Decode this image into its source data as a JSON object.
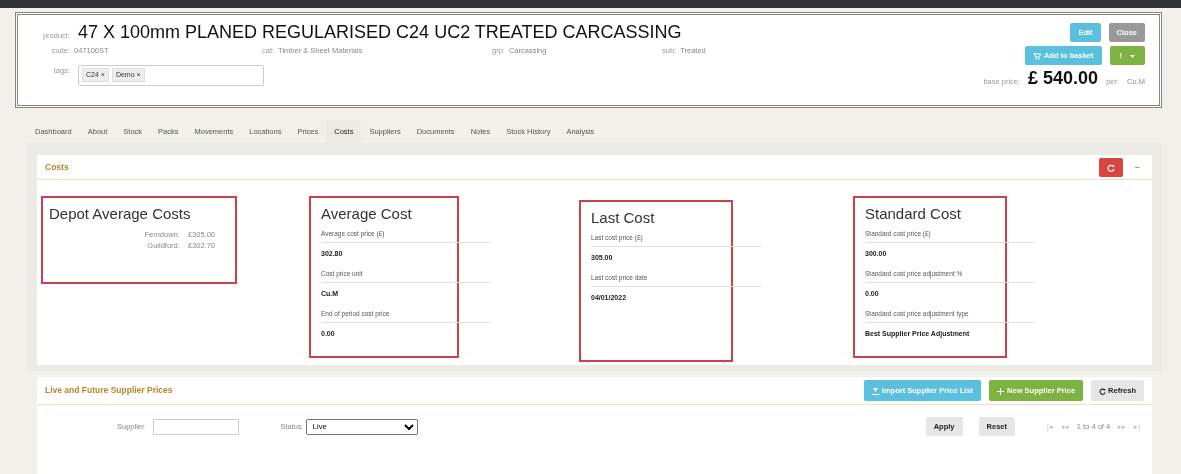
{
  "product": {
    "label": "product:",
    "title": "47 X 100mm PLANED REGULARISED C24 UC2 TREATED CARCASSING",
    "fields": [
      {
        "label": "code:",
        "value": "047100ST"
      },
      {
        "label": "cat:",
        "value": "Timber & Sheet Materials"
      },
      {
        "label": "grp:",
        "value": "Carcassing"
      },
      {
        "label": "sub:",
        "value": "Treated"
      }
    ],
    "tags_label": "tags:",
    "tags": [
      {
        "text": "C24",
        "remove": "×"
      },
      {
        "text": "Demo",
        "remove": "×"
      }
    ],
    "buttons": [
      {
        "kind": "edit",
        "label": "Edit"
      },
      {
        "kind": "close",
        "label": "Close"
      },
      {
        "kind": "basket",
        "label": "Add to basket"
      },
      {
        "kind": "actions",
        "label": "!"
      }
    ],
    "base_price_label": "base price:",
    "base_price": "£ 540.00",
    "per_label": "per:",
    "unit": "Cu.M"
  },
  "tabs": [
    {
      "label": "Dashboard",
      "selected": false
    },
    {
      "label": "About",
      "selected": false
    },
    {
      "label": "Stock",
      "selected": false
    },
    {
      "label": "Packs",
      "selected": false
    },
    {
      "label": "Movements",
      "selected": false
    },
    {
      "label": "Locations",
      "selected": false
    },
    {
      "label": "Prices",
      "selected": false
    },
    {
      "label": "Costs",
      "selected": true
    },
    {
      "label": "Suppliers",
      "selected": false
    },
    {
      "label": "Documents",
      "selected": false
    },
    {
      "label": "Notes",
      "selected": false
    },
    {
      "label": "Stock History",
      "selected": false
    },
    {
      "label": "Analysis",
      "selected": false
    }
  ],
  "costs_panel": {
    "title": "Costs",
    "collapse": "−",
    "depot": {
      "title": "Depot Average Costs",
      "rows": [
        {
          "depot": "Ferndown:",
          "value": "£305.00"
        },
        {
          "depot": "Guildford:",
          "value": "£302.70"
        }
      ]
    },
    "boxes": [
      {
        "title": "Average Cost",
        "fields": [
          {
            "label": "Average cost price (£)",
            "value": "302.80"
          },
          {
            "label": "Cost price unit",
            "value": "Cu.M"
          },
          {
            "label": "End of period cost price",
            "value": "0.00"
          }
        ]
      },
      {
        "title": "Last Cost",
        "fields": [
          {
            "label": "Last cost price (£)",
            "value": "305.00"
          },
          {
            "label": "Last cost price date",
            "value": "04/01/2022"
          }
        ]
      },
      {
        "title": "Standard Cost",
        "fields": [
          {
            "label": "Standard cost price (£)",
            "value": "300.00"
          },
          {
            "label": "Standard cost price adjustment %",
            "value": "0.00"
          },
          {
            "label": "Standard cost price adjustment type",
            "value": "Best Supplier Price Adjustment"
          }
        ]
      }
    ]
  },
  "supplier_prices": {
    "title": "Live and Future Supplier Prices",
    "buttons": [
      {
        "kind": "import",
        "label": "Import Supplier Price List"
      },
      {
        "kind": "new",
        "label": "New Supplier Price"
      },
      {
        "kind": "refresh",
        "label": "Refresh"
      }
    ],
    "supplier_label": "Supplier",
    "status_label": "Status",
    "status_value": "Live",
    "filter_buttons": [
      "Apply",
      "Reset"
    ],
    "pager": {
      "first": "|◂",
      "prev": "◂◂",
      "summary": "1 to 4 of 4",
      "next": "▸▸",
      "last": "▸|"
    }
  }
}
